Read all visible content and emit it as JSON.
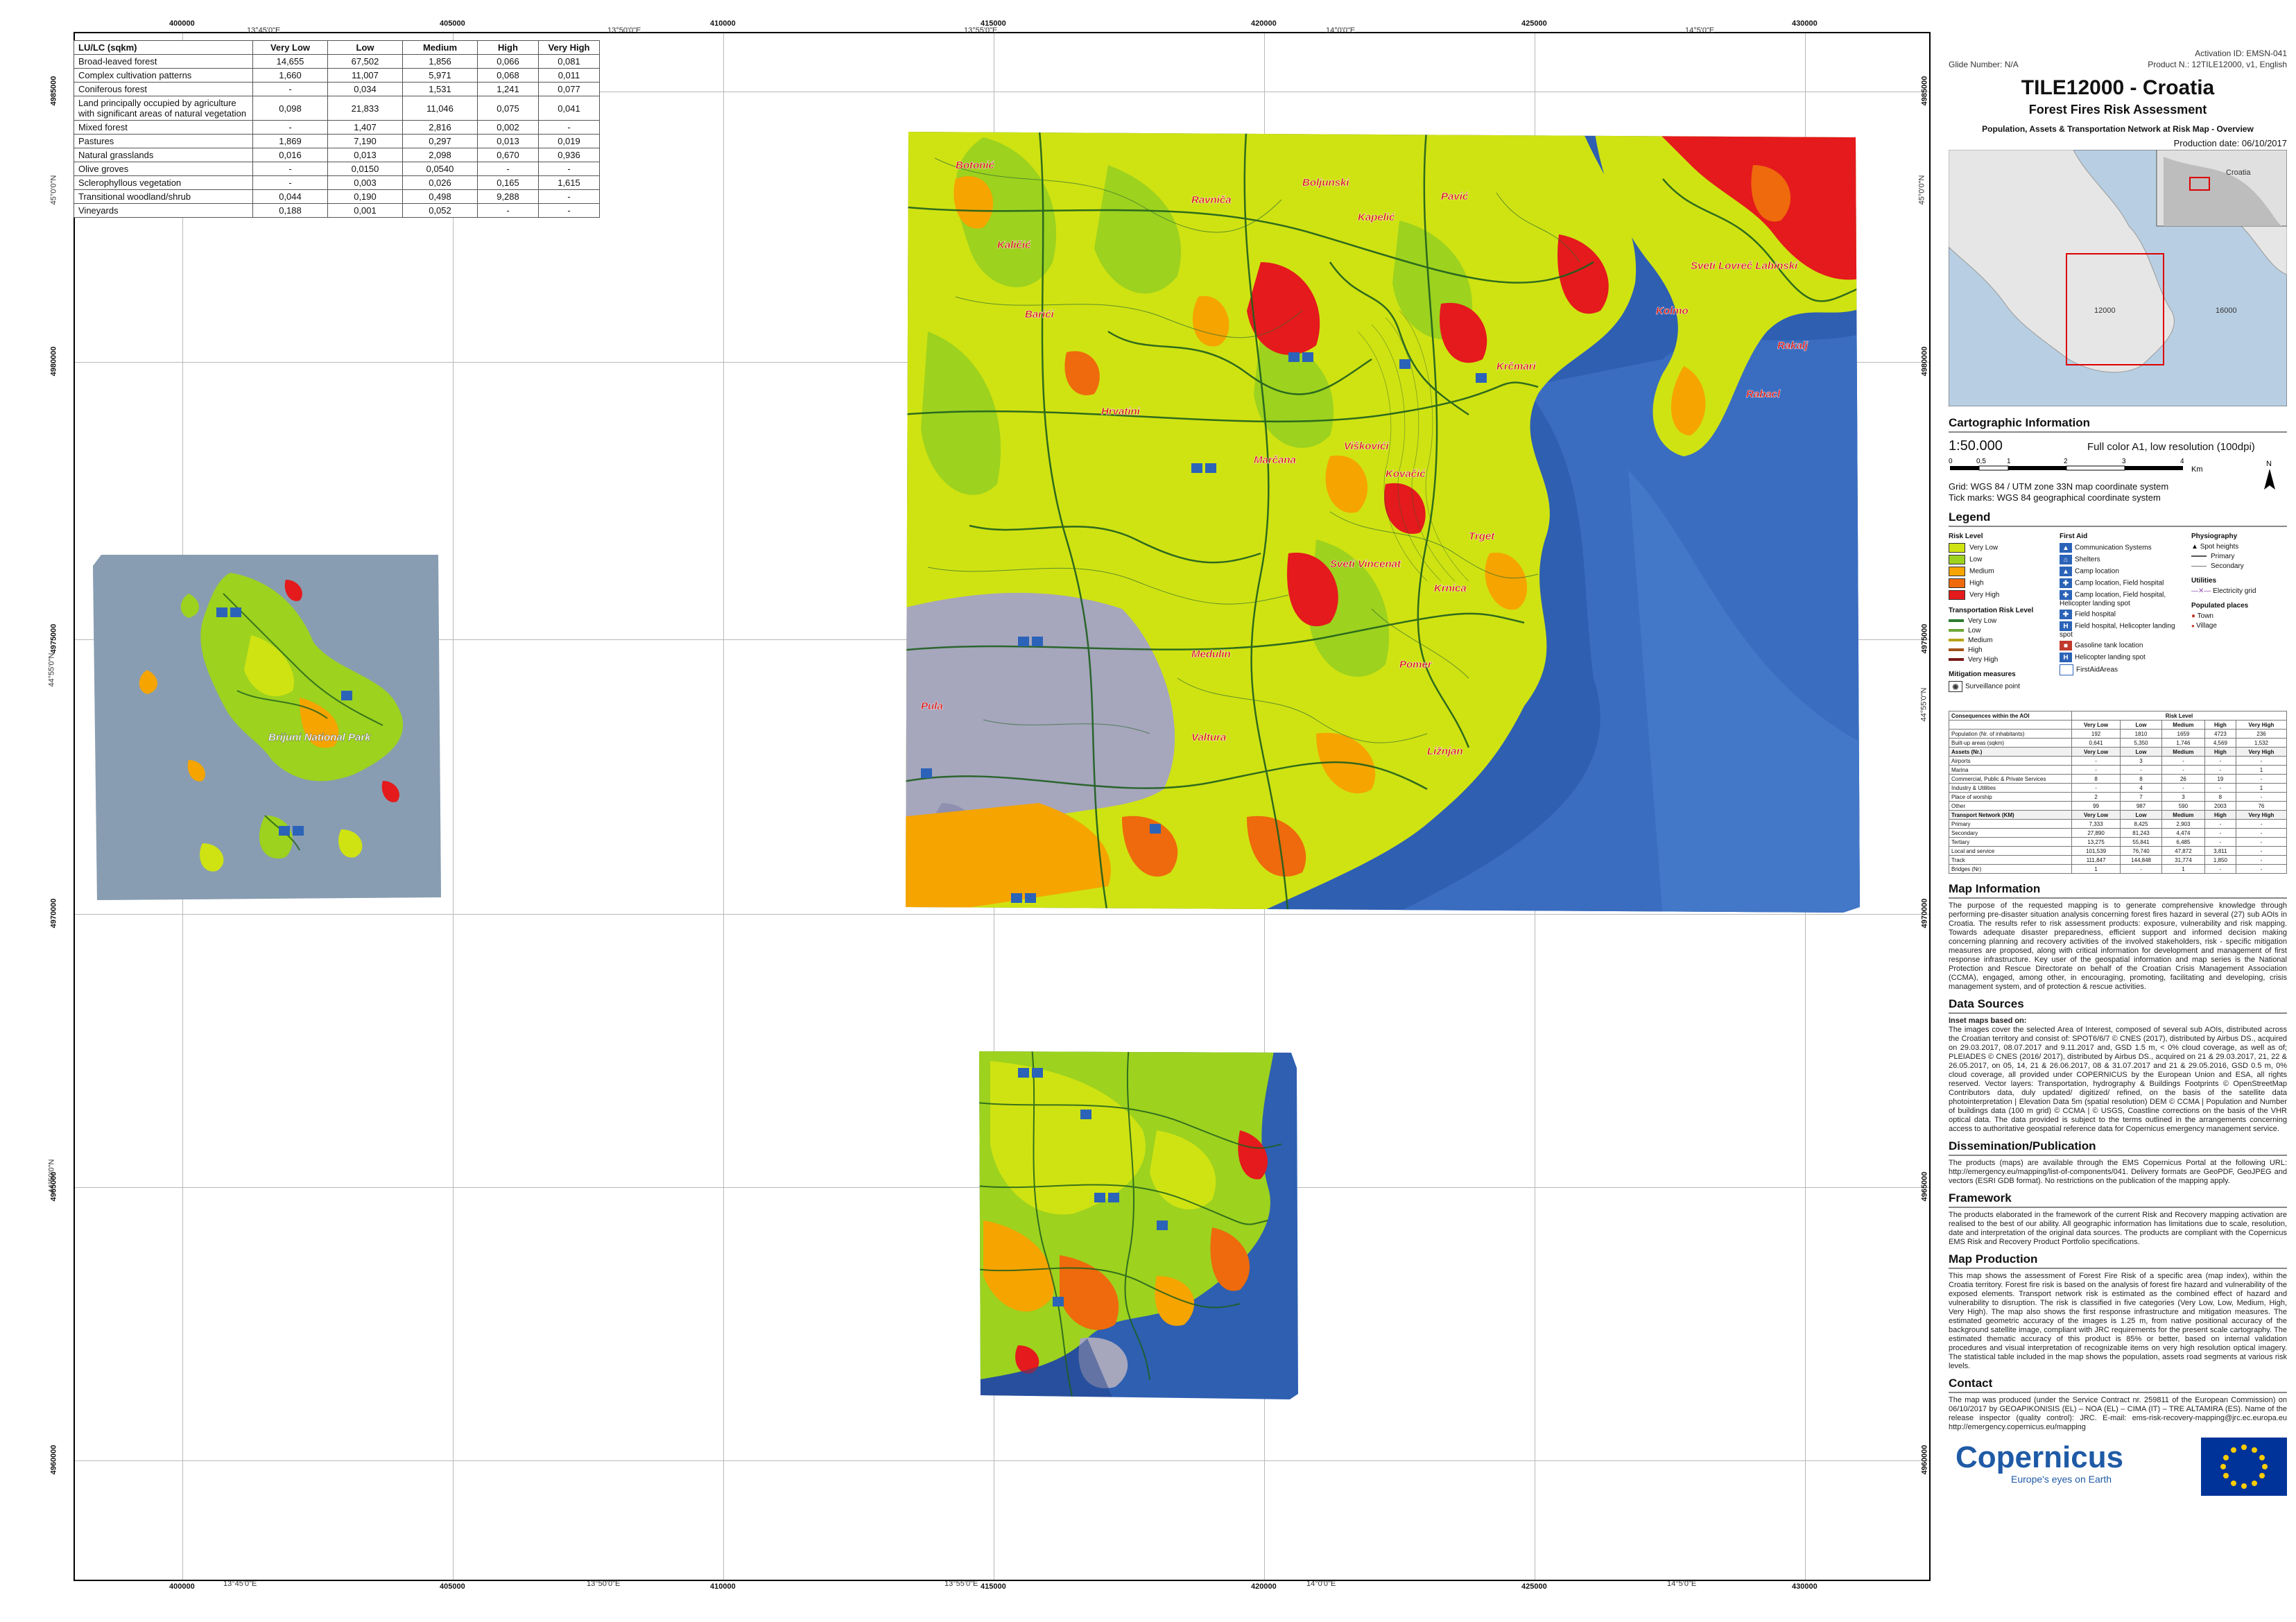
{
  "colors": {
    "very_low": "#cfe312",
    "low": "#9dd21e",
    "medium": "#f5a400",
    "high": "#ee6a0c",
    "very_high": "#e41a1c",
    "sea": "#2e5fb1",
    "roads": "#1e5e1e",
    "build": "#a6a6bd"
  },
  "coords": {
    "top_easting": [
      "400000",
      "405000",
      "410000",
      "415000",
      "420000",
      "425000",
      "430000"
    ],
    "bottom_easting": [
      "400000",
      "405000",
      "410000",
      "415000",
      "420000",
      "425000",
      "430000"
    ],
    "top_geo": [
      "13°45'0\"E",
      "13°50'0\"E",
      "13°55'0\"E",
      "14°0'0\"E",
      "14°5'0\"E"
    ],
    "bottom_geo": [
      "13°45'0\"E",
      "13°50'0\"E",
      "13°55'0\"E",
      "14°0'0\"E",
      "14°5'0\"E"
    ],
    "northing": [
      "4985000",
      "4980000",
      "4975000",
      "4970000",
      "4965000",
      "4960000"
    ],
    "left_geo": [
      "45°0'0\"N",
      "44°55'0\"N",
      "44°50'0\"N"
    ],
    "right_geo": [
      "45°0'0\"N",
      "44°55'0\"N"
    ]
  },
  "lulc": {
    "headers": [
      "LU/LC (sqkm)",
      "Very Low",
      "Low",
      "Medium",
      "High",
      "Very High"
    ],
    "rows": [
      [
        "Broad-leaved forest",
        "14,655",
        "67,502",
        "1,856",
        "0,066",
        "0,081"
      ],
      [
        "Complex cultivation patterns",
        "1,660",
        "11,007",
        "5,971",
        "0,068",
        "0,011"
      ],
      [
        "Coniferous forest",
        "-",
        "0,034",
        "1,531",
        "1,241",
        "0,077"
      ],
      [
        "Land principally occupied by agriculture with significant areas of natural vegetation",
        "0,098",
        "21,833",
        "11,046",
        "0,075",
        "0,041"
      ],
      [
        "Mixed forest",
        "-",
        "1,407",
        "2,816",
        "0,002",
        "-"
      ],
      [
        "Pastures",
        "1,869",
        "7,190",
        "0,297",
        "0,013",
        "0,019"
      ],
      [
        "Natural grasslands",
        "0,016",
        "0,013",
        "2,098",
        "0,670",
        "0,936"
      ],
      [
        "Olive groves",
        "-",
        "0,0150",
        "0,0540",
        "-",
        "-"
      ],
      [
        "Sclerophyllous vegetation",
        "-",
        "0,003",
        "0,026",
        "0,165",
        "1,615"
      ],
      [
        "Transitional woodland/shrub",
        "0,044",
        "0,190",
        "0,498",
        "9,288",
        "-"
      ],
      [
        "Vineyards",
        "0,188",
        "0,001",
        "0,052",
        "-",
        "-"
      ]
    ]
  },
  "map_labels": {
    "main": [
      "Botonić",
      "Boljunski",
      "Ravniča",
      "Kapelić",
      "Kaličić",
      "Pavić",
      "Sveti Lovreč Labinski",
      "Barići",
      "Kolmo",
      "Krčmari",
      "Rabacl",
      "Rakalj",
      "Hrvatini",
      "Viškovići",
      "Kovačić",
      "Marčana",
      "Sveti Vincenat",
      "Trget",
      "Krnica",
      "Medulin",
      "Pomer",
      "Ližnjan",
      "Valtura",
      "Pula"
    ],
    "island": [
      "Brijuni National Park"
    ]
  },
  "panel": {
    "glide": "Glide Number: N/A",
    "activation": "Activation ID: EMSN-041",
    "product": "Product N.: 12TILE12000, v1, English",
    "title": "TILE12000 - Croatia",
    "subtitle": "Forest Fires Risk Assessment",
    "map_type": "Population, Assets & Transportation Network at Risk Map - Overview",
    "production_date": "Production date: 06/10/2017",
    "overview_labels": [
      "Croatia",
      "12000",
      "16000"
    ],
    "carto_head": "Cartographic Information",
    "scale": "1:50.000",
    "print_info": "Full color A1, low resolution (100dpi)",
    "scale_ticks": [
      "0",
      "0,5",
      "1",
      "2",
      "3",
      "4"
    ],
    "scale_unit": "Km",
    "grid_info": "Grid: WGS 84 / UTM zone 33N map coordinate system",
    "tick_info": "Tick marks: WGS 84 geographical coordinate system",
    "north": "N",
    "legend_head": "Legend",
    "risk_level_head": "Risk Level",
    "risk_levels": [
      "Very Low",
      "Low",
      "Medium",
      "High",
      "Very High"
    ],
    "trans_head": "Transportation Risk Level",
    "mitig_head": "Mitigation measures",
    "mitig_items": [
      "Surveillance point"
    ],
    "first_aid_head": "First Aid",
    "first_aid_items": [
      "Communication Systems",
      "Shelters",
      "Camp location",
      "Camp location, Field hospital",
      "Camp location, Field hospital, Helicopter landing spot",
      "Field hospital",
      "Field hospital, Helicopter landing spot",
      "Gasoline tank location",
      "Helicopter landing spot",
      "FirstAidAreas"
    ],
    "physio_head": "Physiography",
    "physio_items": [
      "Spot heights",
      "Primary",
      "Secondary"
    ],
    "util_head": "Utilities",
    "util_items": [
      "Electricity grid"
    ],
    "pop_head": "Populated places",
    "pop_items": [
      "Town",
      "Village"
    ],
    "cons_title": "Consequences within the AOI",
    "cons_risk": "Risk Level",
    "cons_levels": [
      "Very Low",
      "Low",
      "Medium",
      "High",
      "Very High"
    ],
    "cons_rows": [
      [
        "Population (Nr. of inhabitants)",
        "192",
        "1810",
        "1659",
        "4723",
        "236"
      ],
      [
        "Built-up areas (sqkm)",
        "0,641",
        "5,350",
        "1,746",
        "4,569",
        "1,532"
      ]
    ],
    "cons_assets_head": "Assets (Nr.)",
    "cons_assets": [
      [
        "Airports",
        "-",
        "3",
        "-",
        "-",
        "-"
      ],
      [
        "Marina",
        "-",
        "-",
        "-",
        "-",
        "1"
      ],
      [
        "Commercial, Public & Private Services",
        "8",
        "8",
        "26",
        "19",
        "-"
      ],
      [
        "Industry & Utilities",
        "-",
        "4",
        "-",
        "-",
        "1"
      ],
      [
        "Place of worship",
        "2",
        "7",
        "3",
        "8",
        "-"
      ],
      [
        "Other",
        "99",
        "987",
        "590",
        "2003",
        "76"
      ]
    ],
    "cons_trans_head": "Transport Network (KM)",
    "cons_trans": [
      [
        "Primary",
        "7,333",
        "8,425",
        "2,903",
        "-",
        "-"
      ],
      [
        "Secondary",
        "27,890",
        "81,243",
        "4,474",
        "-",
        "-"
      ],
      [
        "Tertiary",
        "13,275",
        "55,841",
        "6,485",
        "-",
        "-"
      ],
      [
        "Local and service",
        "101,539",
        "76,740",
        "47,872",
        "3,811",
        "-"
      ],
      [
        "Track",
        "111,847",
        "144,848",
        "31,774",
        "1,850",
        "-"
      ],
      [
        "Bridges (Nr)",
        "1",
        "-",
        "1",
        "-",
        "-"
      ]
    ],
    "map_info_head": "Map Information",
    "map_info_text": "The purpose of the requested mapping is to generate comprehensive knowledge through performing pre-disaster situation analysis concerning forest fires hazard in several (27) sub AOIs in Croatia. The results refer to risk assessment products: exposure, vulnerability and risk mapping. Towards adequate disaster preparedness, efficient support and informed decision making concerning planning and recovery activities of the involved stakeholders, risk - specific mitigation measures are proposed, along with critical information for development and management of first response infrastructure. Key user of the geospatial information and map series is the National Protection and Rescue Directorate on behalf of the Croatian Crisis Management Association (CCMA), engaged, among other, in encouraging, promoting, facilitating and developing, crisis management system, and of protection & rescue activities.",
    "data_sources_head": "Data Sources",
    "data_sources_sub": "Inset maps based on:",
    "data_sources_text": "The images cover the selected Area of Interest, composed of several sub AOIs, distributed across the Croatian territory and consist of: SPOT6/6/7 © CNES (2017), distributed by Airbus DS., acquired on 29.03.2017, 08.07.2017 and 9.11.2017 and, GSD 1.5 m, < 0% cloud coverage, as well as of; PLEIADES © CNES (2016/ 2017), distributed by Airbus DS., acquired on 21 & 29.03.2017, 21, 22 & 26.05.2017, on 05, 14, 21 & 26.06.2017, 08 & 31.07.2017 and 21 & 29.05.2016, GSD 0.5 m, 0% cloud coverage, all provided under COPERNICUS by the European Union and ESA, all rights reserved. Vector layers: Transportation, hydrography & Buildings Footprints © OpenStreetMap Contributors data, duly updated/ digitized/ refined, on the basis of the satellite data photointerpretation | Elevation Data 5m (spatial resolution) DEM © CCMA | Population and Number of buildings data (100 m grid) © CCMA | © USGS, Coastline corrections on the basis of the VHR optical data. The data provided is subject to the terms outlined in the arrangements concerning access to authoritative geospatial reference data for Copernicus emergency management service.",
    "dissem_head": "Dissemination/Publication",
    "dissem_text": "The products (maps) are available through the EMS Copernicus Portal at the following URL: http://emergency.eu/mapping/list-of-components/041. Delivery formats are GeoPDF, GeoJPEG and vectors (ESRI GDB format). No restrictions on the publication of the mapping apply.",
    "framework_head": "Framework",
    "framework_text": "The products elaborated in the framework of the current Risk and Recovery mapping activation are realised to the best of our ability. All geographic information has limitations due to scale, resolution, date and interpretation of the original data sources. The products are compliant with the Copernicus EMS Risk and Recovery Product Portfolio specifications.",
    "production_head": "Map Production",
    "production_text": "This map shows the assessment of Forest Fire Risk of a specific area (map index), within the Croatia territory. Forest fire risk is based on the analysis of forest fire hazard and vulnerability of the exposed elements. Transport network risk is estimated as the combined effect of hazard and vulnerability to disruption. The risk is classified in five categories (Very Low, Low, Medium, High, Very High). The map also shows the first response infrastructure and mitigation measures. The estimated geometric accuracy of the images is 1.25 m, from native positional accuracy of the background satellite image, compliant with JRC requirements for the present scale cartography. The estimated thematic accuracy of this product is 85% or better, based on internal validation procedures and visual interpretation of recognizable items on very high resolution optical imagery. The statistical table included in the map shows the population, assets road segments at various risk levels.",
    "contact_head": "Contact",
    "contact_text": "The map was produced (under the Service Contract nr. 259811 of the European Commission) on 06/10/2017 by GEOAPIKONISIS (EL) – NOA (EL) – CIMA (IT) – TRE ALTAMIRA (ES). Name of the release inspector (quality control): JRC. E-mail: ems-risk-recovery-mapping@jrc.ec.europa.eu http://emergency.copernicus.eu/mapping",
    "copernicus": "Copernicus",
    "copernicus_tag": "Europe's eyes on Earth"
  }
}
